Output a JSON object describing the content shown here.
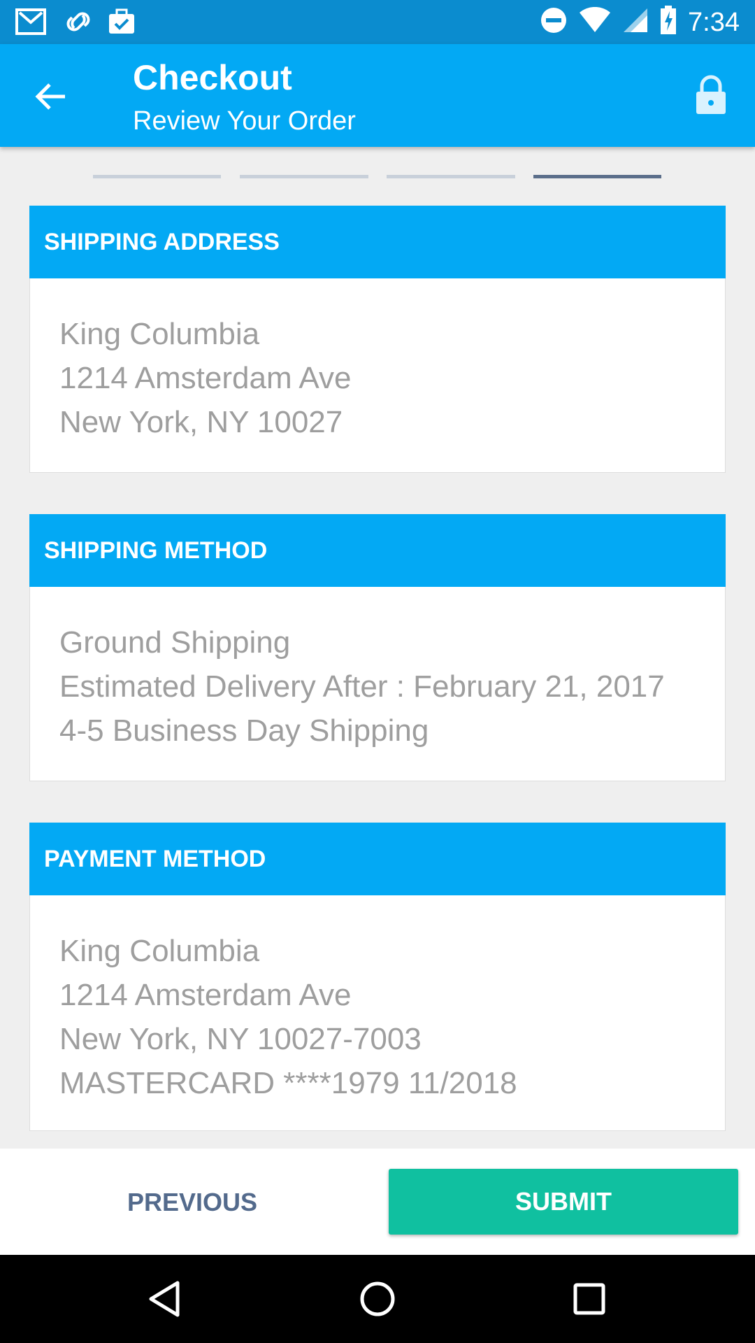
{
  "status_bar": {
    "time": "7:34",
    "left_icons": [
      "gmail-icon",
      "link-icon",
      "briefcase-check-icon"
    ],
    "right_icons": [
      "do-not-disturb-icon",
      "wifi-icon",
      "signal-icon",
      "battery-charging-icon"
    ]
  },
  "app_bar": {
    "title": "Checkout",
    "subtitle": "Review Your Order",
    "back_icon": "arrow-back-icon",
    "lock_icon": "lock-icon"
  },
  "progress": {
    "steps": 4,
    "current": 4
  },
  "sections": {
    "shipping_address": {
      "header": "SHIPPING ADDRESS",
      "lines": [
        "King Columbia",
        "1214 Amsterdam Ave",
        "New York, NY 10027"
      ]
    },
    "shipping_method": {
      "header": "SHIPPING METHOD",
      "lines": [
        "Ground Shipping",
        "Estimated Delivery After : February 21, 2017",
        "4-5 Business Day Shipping"
      ]
    },
    "payment_method": {
      "header": "PAYMENT METHOD",
      "lines": [
        "King Columbia",
        "1214 Amsterdam Ave",
        "New York, NY 10027-7003",
        "MASTERCARD ****1979 11/2018"
      ]
    }
  },
  "actions": {
    "previous_label": "PREVIOUS",
    "submit_label": "SUBMIT"
  },
  "colors": {
    "primary": "#03a9f4",
    "status_bar": "#0b8ccf",
    "accent": "#10c0a0",
    "prev_text": "#536a8c"
  }
}
